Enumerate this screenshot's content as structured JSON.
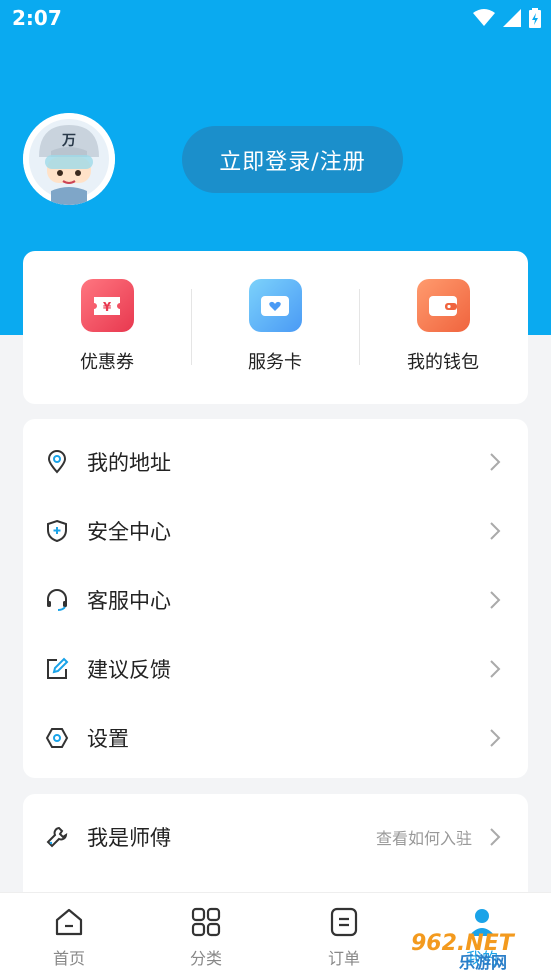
{
  "status_bar": {
    "time": "2:07"
  },
  "profile": {
    "login_label": "立即登录/注册"
  },
  "quick_actions": [
    {
      "label": "优惠券",
      "icon": "coupon-icon",
      "color": "#f24e5d"
    },
    {
      "label": "服务卡",
      "icon": "service-card-icon",
      "color": "#4ea8f8"
    },
    {
      "label": "我的钱包",
      "icon": "wallet-icon",
      "color": "#f6734a"
    }
  ],
  "menu": [
    {
      "label": "我的地址",
      "icon": "location-pin-icon"
    },
    {
      "label": "安全中心",
      "icon": "shield-icon"
    },
    {
      "label": "客服中心",
      "icon": "headset-icon"
    },
    {
      "label": "建议反馈",
      "icon": "edit-icon"
    },
    {
      "label": "设置",
      "icon": "settings-hexagon-icon"
    }
  ],
  "master": {
    "label": "我是师傅",
    "hint": "查看如何入驻",
    "icon": "wrench-icon"
  },
  "bottom_nav": [
    {
      "label": "首页",
      "icon": "home-icon"
    },
    {
      "label": "分类",
      "icon": "category-icon"
    },
    {
      "label": "订单",
      "icon": "order-icon"
    },
    {
      "label": "我的",
      "icon": "profile-icon",
      "active": true
    }
  ],
  "watermark": {
    "text_top": "962.NET",
    "text_bottom": "乐游网"
  },
  "colors": {
    "header": "#0aaaf0",
    "accent": "#1b8fcb",
    "background": "#f3f4f6"
  }
}
